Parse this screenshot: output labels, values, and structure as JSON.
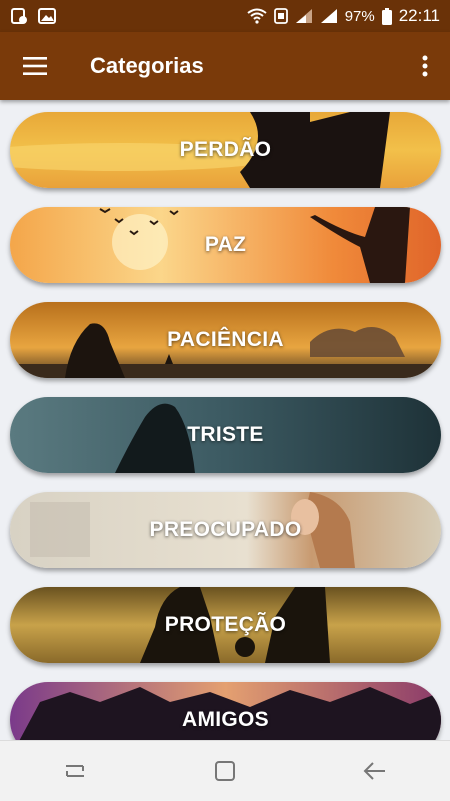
{
  "status_bar": {
    "battery": "97%",
    "time": "22:11",
    "icons": [
      "gallery-notification-icon",
      "image-notification-icon",
      "wifi-icon",
      "volte-icon",
      "signal-icon",
      "battery-icon"
    ]
  },
  "app_bar": {
    "title": "Categorias",
    "menu_icon": "hamburger-menu-icon",
    "overflow_icon": "more-vert-icon"
  },
  "categories": [
    {
      "label": "PERDÃO"
    },
    {
      "label": "PAZ"
    },
    {
      "label": "PACIÊNCIA"
    },
    {
      "label": "TRISTE"
    },
    {
      "label": "PREOCUPADO"
    },
    {
      "label": "PROTEÇÃO"
    },
    {
      "label": "AMIGOS"
    }
  ],
  "nav_bar": {
    "icons": [
      "recent-apps-icon",
      "home-icon",
      "back-icon"
    ]
  },
  "colors": {
    "status_bar": "#6a3208",
    "app_bar": "#7a3a0a",
    "background": "#eef0f4"
  }
}
